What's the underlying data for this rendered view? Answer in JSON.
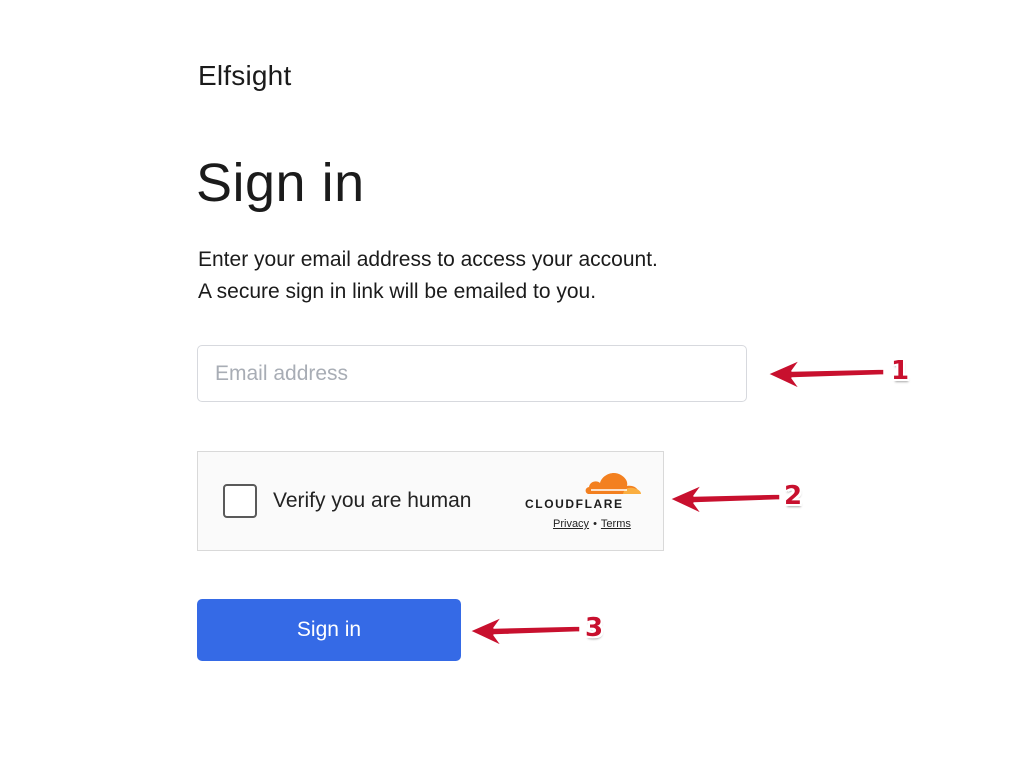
{
  "brand": {
    "name": "Elfsight"
  },
  "header": {
    "title": "Sign in"
  },
  "description": {
    "line1": "Enter your email address to access your account.",
    "line2": "A secure sign in link will be emailed to you."
  },
  "email": {
    "placeholder": "Email address",
    "value": ""
  },
  "captcha": {
    "label": "Verify you are human",
    "provider": "CLOUDFLARE",
    "privacy_link": "Privacy",
    "separator": "•",
    "terms_link": "Terms",
    "checked": false,
    "provider_color": "#f38020"
  },
  "submit": {
    "label": "Sign in",
    "color": "#356ae6"
  },
  "annotations": [
    {
      "number": "1",
      "target": "email-input"
    },
    {
      "number": "2",
      "target": "captcha-widget"
    },
    {
      "number": "3",
      "target": "sign-in-button"
    }
  ],
  "annotation_color": "#c8102e"
}
